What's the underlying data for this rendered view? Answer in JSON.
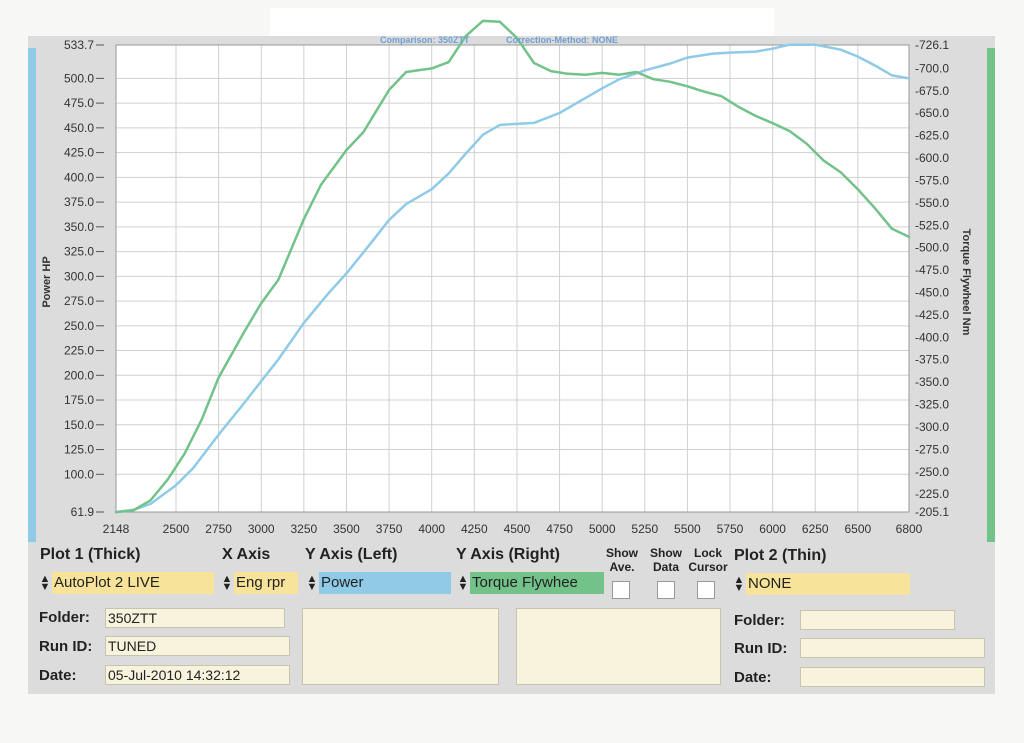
{
  "chart_data": {
    "type": "line",
    "title": "",
    "top_note_left": "Comparison: 350ZTT",
    "top_note_right": "Correction-Method: NONE",
    "xlabel": "",
    "ylabel_left": "Power HP",
    "ylabel_right": "Torque Flywheel Nm",
    "x_ticks": [
      "2148",
      "2500",
      "2750",
      "3000",
      "3250",
      "3500",
      "3750",
      "4000",
      "4250",
      "4500",
      "4750",
      "5000",
      "5250",
      "5500",
      "5750",
      "6000",
      "6250",
      "6500",
      "6800"
    ],
    "y_left_ticks": [
      "533.7",
      "500.0",
      "475.0",
      "450.0",
      "425.0",
      "400.0",
      "375.0",
      "350.0",
      "325.0",
      "300.0",
      "275.0",
      "250.0",
      "225.0",
      "200.0",
      "175.0",
      "150.0",
      "125.0",
      "100.0",
      "61.9"
    ],
    "y_right_ticks": [
      "-726.1",
      "-700.0",
      "-675.0",
      "-650.0",
      "-625.0",
      "-600.0",
      "-575.0",
      "-550.0",
      "-525.0",
      "-500.0",
      "-475.0",
      "-450.0",
      "-425.0",
      "-400.0",
      "-375.0",
      "-350.0",
      "-325.0",
      "-300.0",
      "-275.0",
      "-250.0",
      "-225.0",
      "-205.1"
    ],
    "xlim": [
      2148,
      6800
    ],
    "ylim_left": [
      61.9,
      533.7
    ],
    "ylim_right": [
      205.1,
      726.1
    ],
    "grid": true,
    "series": [
      {
        "name": "Power",
        "axis": "left",
        "color": "#8fcbe6",
        "x": [
          2148,
          2250,
          2350,
          2500,
          2600,
          2750,
          2900,
          3000,
          3100,
          3250,
          3400,
          3500,
          3650,
          3750,
          3850,
          4000,
          4100,
          4200,
          4300,
          4400,
          4500,
          4600,
          4750,
          4900,
          5000,
          5100,
          5250,
          5400,
          5500,
          5650,
          5750,
          5900,
          6000,
          6100,
          6250,
          6400,
          6500,
          6600,
          6700,
          6800
        ],
        "y": [
          61.9,
          64,
          70,
          89,
          106,
          140,
          172,
          194,
          216,
          253,
          284,
          303,
          335,
          357,
          373,
          388,
          404,
          424,
          443,
          453,
          454,
          455,
          465,
          480,
          490,
          499,
          508,
          515,
          521,
          525,
          526,
          527,
          530,
          534,
          534,
          529,
          522,
          513,
          503,
          500
        ]
      },
      {
        "name": "Torque Flywheel",
        "axis": "right",
        "color": "#72c28a",
        "x": [
          2148,
          2250,
          2350,
          2450,
          2550,
          2650,
          2750,
          2900,
          3000,
          3100,
          3250,
          3350,
          3500,
          3600,
          3750,
          3850,
          4000,
          4100,
          4200,
          4300,
          4400,
          4500,
          4600,
          4700,
          4800,
          4900,
          5000,
          5100,
          5200,
          5300,
          5400,
          5500,
          5600,
          5700,
          5800,
          5900,
          6000,
          6100,
          6200,
          6300,
          6400,
          6500,
          6600,
          6700,
          6800
        ],
        "y": [
          205,
          207,
          218,
          241,
          270,
          308,
          355,
          406,
          438,
          464,
          532,
          570,
          609,
          629,
          676,
          696,
          700,
          707,
          736,
          753,
          752,
          734,
          706,
          697,
          694,
          693,
          695,
          693,
          696,
          688,
          685,
          680,
          674,
          669,
          657,
          647,
          639,
          630,
          616,
          597,
          584,
          565,
          544,
          521,
          512
        ]
      }
    ]
  },
  "controls": {
    "plot1": {
      "header": "Plot 1 (Thick)",
      "value": "AutoPlot 2 LIVE",
      "folder_label": "Folder:",
      "folder_value": "350ZTT",
      "runid_label": "Run ID:",
      "runid_value": "TUNED",
      "date_label": "Date:",
      "date_value": "05-Jul-2010  14:32:12"
    },
    "x_axis": {
      "header": "X Axis",
      "value": "Eng rpr"
    },
    "y_left": {
      "header": "Y Axis (Left)",
      "value": "Power",
      "color": "#8fcbe6"
    },
    "y_right": {
      "header": "Y Axis (Right)",
      "value": "Torque Flywhee",
      "color": "#72c28a"
    },
    "show_ave": {
      "line1": "Show",
      "line2": "Ave."
    },
    "show_data": {
      "line1": "Show",
      "line2": "Data"
    },
    "lock_cursor": {
      "line1": "Lock",
      "line2": "Cursor"
    },
    "plot2": {
      "header": "Plot 2 (Thin)",
      "value": "NONE",
      "folder_label": "Folder:",
      "runid_label": "Run ID:",
      "date_label": "Date:"
    }
  }
}
